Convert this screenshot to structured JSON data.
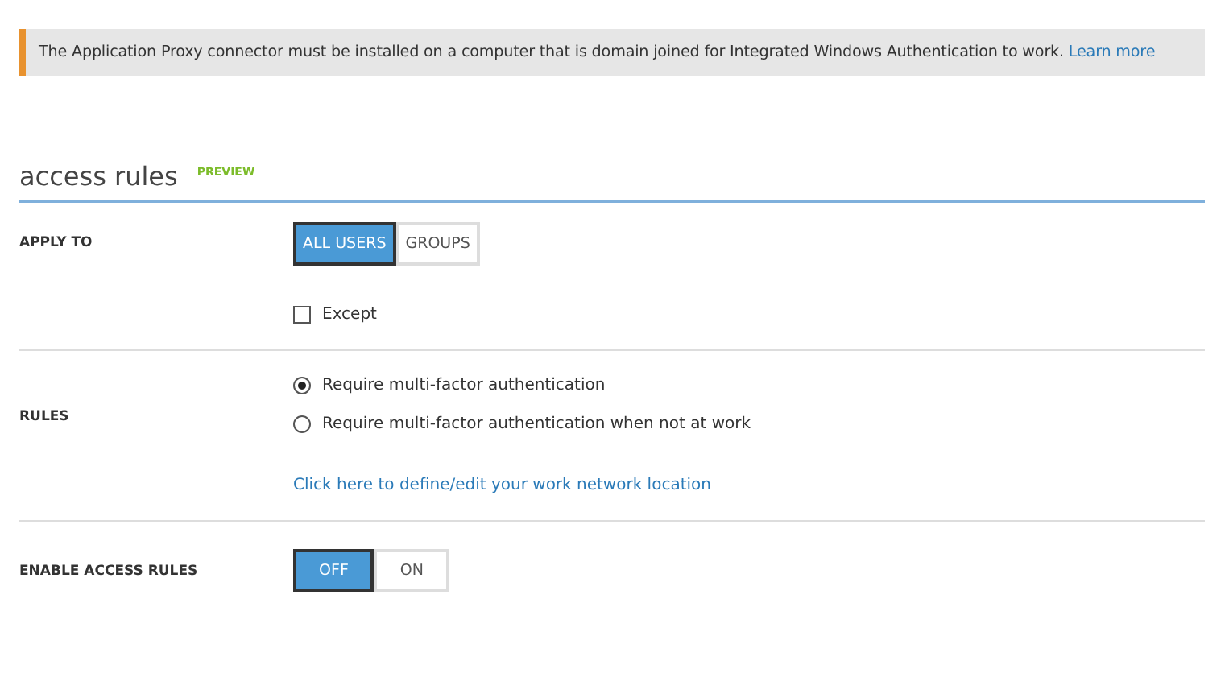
{
  "banner": {
    "text": "The Application Proxy connector must be installed on a computer that is domain joined for Integrated Windows Authentication to work.",
    "link": "Learn more"
  },
  "section": {
    "title": "access rules",
    "badge": "PREVIEW"
  },
  "apply_to": {
    "label": "APPLY TO",
    "options": [
      {
        "label": "ALL USERS",
        "selected": true
      },
      {
        "label": "GROUPS",
        "selected": false
      }
    ],
    "except": {
      "label": "Except",
      "checked": false
    }
  },
  "rules": {
    "label": "RULES",
    "options": [
      {
        "label": "Require multi-factor authentication",
        "selected": true
      },
      {
        "label": "Require multi-factor authentication when not at work",
        "selected": false
      }
    ],
    "link": "Click here to define/edit your work network location"
  },
  "enable": {
    "label": "ENABLE ACCESS RULES",
    "options": [
      {
        "label": "OFF",
        "selected": true
      },
      {
        "label": "ON",
        "selected": false
      }
    ]
  }
}
